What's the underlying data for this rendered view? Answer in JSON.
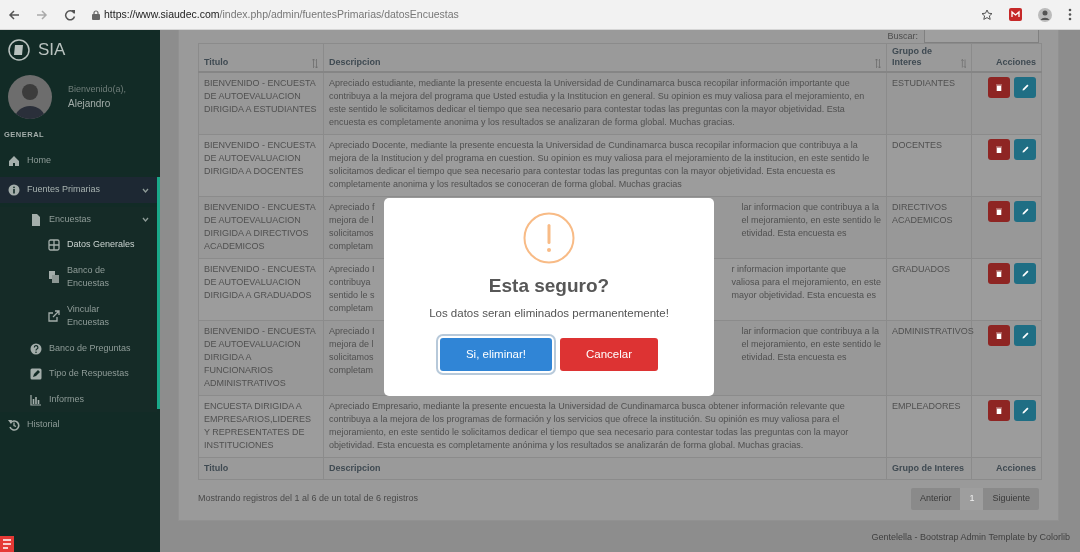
{
  "browser": {
    "url_host": "https://www.siaudec.com",
    "url_path": "/index.php/admin/fuentesPrimarias/datosEncuestas"
  },
  "sidebar": {
    "brand": "SIA",
    "welcome": "Bienvenido(a),",
    "user": "Alejandro",
    "section": "GENERAL",
    "items": [
      {
        "label": "Home",
        "selected": false
      },
      {
        "label": "Fuentes Primarias",
        "selected": true,
        "expanded": true,
        "children": [
          {
            "label": "Encuestas",
            "selected": false,
            "expanded": true,
            "children": [
              {
                "label": "Datos Generales",
                "selected": true
              },
              {
                "label": "Banco de Encuestas",
                "selected": false
              },
              {
                "label": "Vincular Encuestas",
                "selected": false
              }
            ]
          },
          {
            "label": "Banco de Preguntas",
            "selected": false
          },
          {
            "label": "Tipo de Respuestas",
            "selected": false
          },
          {
            "label": "Informes",
            "selected": false
          }
        ]
      },
      {
        "label": "Historial",
        "selected": false
      }
    ]
  },
  "search": {
    "label": "Buscar:"
  },
  "table": {
    "columns": [
      {
        "label": "Titulo",
        "sortable": true
      },
      {
        "label": "Descripcion",
        "sortable": true
      },
      {
        "label": "Grupo de Interes",
        "sortable": true
      },
      {
        "label": "Acciones",
        "sortable": false
      }
    ],
    "rows": [
      {
        "title": "BIENVENIDO - ENCUESTA DE AUTOEVALUACION DIRIGIDA A ESTUDIANTES",
        "description": "Apreciado estudiante, mediante la presente encuesta la Universidad de Cundinamarca busca recopilar información importante que contribuya a la mejora del programa que Usted estudia y la Institucion en general. Su opinion es muy valiosa para el mejoramiento, en este sentido le solicitamos dedicar el tiempo que sea necesario para contestar todas las preguntas con la mayor objetividad. Esta encuesta es completamente anonima y los resultados se analizaran de forma global. Muchas gracias.",
        "group": "ESTUDIANTES"
      },
      {
        "title": "BIENVENIDO - ENCUESTA DE AUTOEVALUACION DIRIGIDA A DOCENTES",
        "description": "Apreciado Docente, mediante la presente encuesta la Universidad de Cundinamarca busca recopilar informacion que contribuya a la mejora de la Institucion y del programa en cuestion. Su opinion es muy valiosa para el mejoramiento de la institucion, en este sentido le solicitamos dedicar el tiempo que sea necesario para contestar todas las preguntas con la mayor objetividad. Esta encuesta es completamente anonima y los resultados se conoceran de forma global. Muchas gracias",
        "group": "DOCENTES"
      },
      {
        "title": "BIENVENIDO - ENCUESTA DE AUTOEVALUACION DIRIGIDA A DIRECTIVOS ACADEMICOS",
        "description_fragments": [
          {
            "left": "Apreciado f",
            "right": "lar informacion que contribuya a la"
          },
          {
            "left": "mejora de l",
            "right": "el mejoramiento, en este sentido le"
          },
          {
            "left": "solicitamos",
            "right": "etividad. Esta encuesta es"
          },
          {
            "left": "completam"
          }
        ],
        "group": "DIRECTIVOS ACADEMICOS"
      },
      {
        "title": "BIENVENIDO - ENCUESTA DE AUTOEVALUACION DIRIGIDA A GRADUADOS",
        "description_fragments": [
          {
            "left": "Apreciado I",
            "right": "r informacion importante que"
          },
          {
            "left": "contribuya",
            "right": "valiosa para el mejoramiento, en este"
          },
          {
            "left": "sentido le s",
            "right": "mayor objetividad. Esta encuesta es"
          },
          {
            "left": "completam"
          }
        ],
        "group": "GRADUADOS"
      },
      {
        "title": "BIENVENIDO - ENCUESTA DE AUTOEVALUACION DIRIGIDA A FUNCIONARIOS ADMINISTRATIVOS",
        "description_fragments": [
          {
            "left": "Apreciado I",
            "right": "lar informacion que contribuya a la"
          },
          {
            "left": "mejora de l",
            "right": "el mejoramiento, en este sentido le"
          },
          {
            "left": "solicitamos",
            "right": "etividad. Esta encuesta es"
          },
          {
            "left": "completam"
          }
        ],
        "group": "ADMINISTRATIVOS"
      },
      {
        "title": "ENCUESTA DIRIGIDA A EMPRESARIOS,LIDERES Y REPRESENTATES DE INSTITUCIONES",
        "description": "Apreciado Empresario, mediante la presente encuesta la Universidad de Cundinamarca busca obtener información relevante que contribuya a la mejora de los programas de formación y los servicios que ofrece la institución. Su opinión es muy valiosa para el mejoramiento, en este sentido le solicitamos dedicar el tiempo que sea necesario para contestar todas las preguntas con la mayor objetividad. Esta encuesta es completamente anónima y los resultados se analizarán de forma global. Muchas gracias.",
        "group": "EMPLEADORES"
      }
    ],
    "footer_columns": [
      "Titulo",
      "Descripcion",
      "Grupo de Interes",
      "Acciones"
    ]
  },
  "info": "Mostrando registros del 1 al 6 de un total de 6 registros",
  "pagination": [
    {
      "label": "Anterior",
      "selected": false,
      "disabled": true
    },
    {
      "label": "1",
      "selected": true,
      "disabled": false
    },
    {
      "label": "Siguiente",
      "selected": false,
      "disabled": true
    }
  ],
  "footer": "Gentelella - Bootstrap Admin Template by Colorlib",
  "modal": {
    "title": "Esta seguro?",
    "text": "Los datos seran eliminados permanentemente!",
    "buttons": [
      {
        "label": "Si, eliminar!",
        "kind": "confirm",
        "focused": true
      },
      {
        "label": "Cancelar",
        "kind": "cancel",
        "focused": false
      }
    ]
  }
}
